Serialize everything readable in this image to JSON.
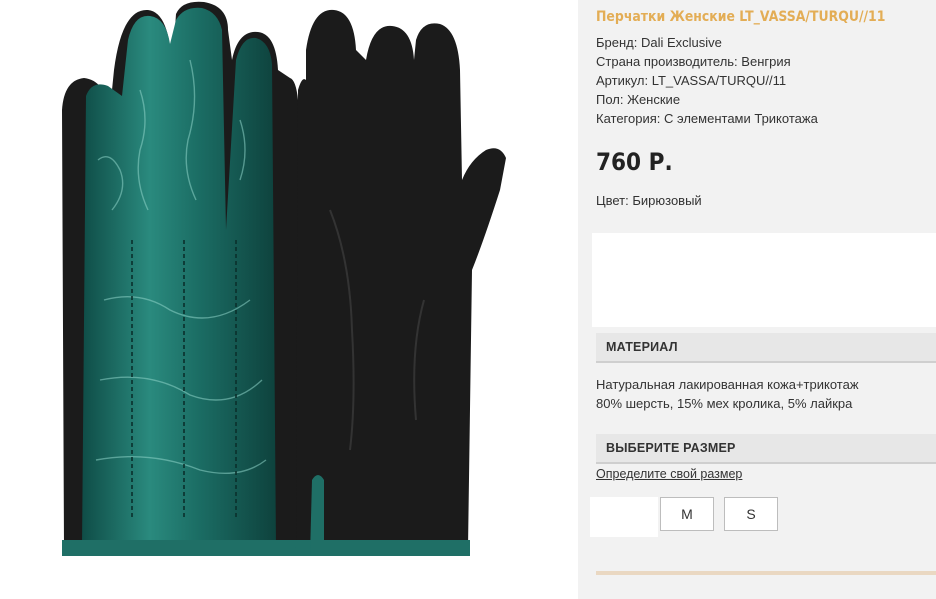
{
  "product": {
    "title": "Перчатки Женские LT_VASSA/TURQU//11",
    "image_alt": "Перчатки Женские LT_VASSA/TURQU//11",
    "attributes": [
      {
        "label": "Бренд: ",
        "value": "Dali Exclusive"
      },
      {
        "label": "Страна производитель: ",
        "value": "Венгрия"
      },
      {
        "label": "Артикул: ",
        "value": "LT_VASSA/TURQU//11"
      },
      {
        "label": "Пол: ",
        "value": "Женские"
      },
      {
        "label": "Категория: ",
        "value": "С элементами Трикотажа"
      }
    ],
    "price": "760 Р.",
    "color_label": "Цвет: ",
    "color_value": "Бирюзовый"
  },
  "material": {
    "header": "МАТЕРИАЛ",
    "lines": [
      "Натуральная лакированная кожа+трикотаж",
      "80% шерсть, 15% мех кролика, 5% лайкра"
    ]
  },
  "size": {
    "header": "ВЫБЕРИТЕ РАЗМЕР",
    "help_link": "Определите свой размер",
    "options": [
      "M",
      "S"
    ]
  },
  "colors": {
    "title": "#e3ad55",
    "leather": "#1f6f66",
    "knit": "#1b1b1b"
  },
  "icons": {
    "product_image": "gloves-photo"
  }
}
